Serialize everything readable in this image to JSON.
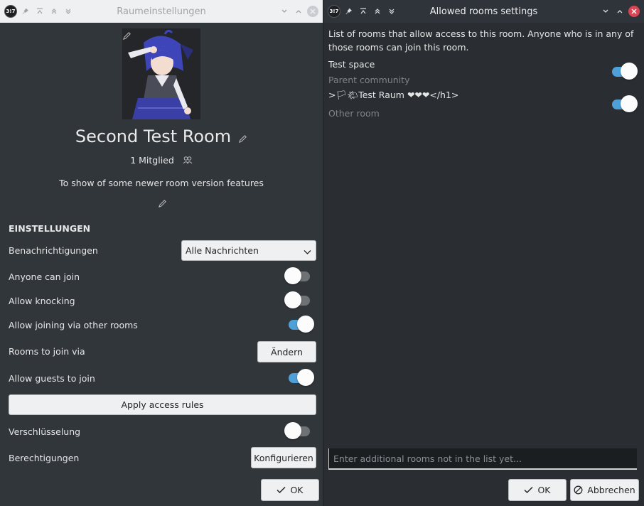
{
  "left_window": {
    "title": "Raumeinstellungen",
    "app_logo_text": "3!7",
    "room": {
      "name": "Second Test Room",
      "members": "1 Mitglied",
      "topic": "To show of some newer room version features"
    },
    "settings": {
      "section_title": "EINSTELLUNGEN",
      "notifications_label": "Benachrichtigungen",
      "notifications_value": "Alle Nachrichten",
      "anyone_can_join_label": "Anyone can join",
      "anyone_can_join": false,
      "allow_knocking_label": "Allow knocking",
      "allow_knocking": false,
      "allow_joining_via_rooms_label": "Allow joining via other rooms",
      "allow_joining_via_rooms": true,
      "rooms_to_join_label": "Rooms to join via",
      "rooms_to_join_button": "Ändern",
      "allow_guests_label": "Allow guests to join",
      "allow_guests": true,
      "apply_button": "Apply access rules",
      "encryption_label": "Verschlüsselung",
      "encryption": false,
      "permissions_label": "Berechtigungen",
      "permissions_button": "Konfigurieren"
    },
    "ok_button": "OK"
  },
  "right_window": {
    "title": "Allowed rooms settings",
    "app_logo_text": "3!7",
    "description": "List of rooms that allow access to this room. Anyone who is in any of those rooms can join this room.",
    "rooms": [
      {
        "name": "Test space",
        "subtitle": "Parent community",
        "enabled": true
      },
      {
        "name": ">🏳🌤Test Raum ❤❤❤</h1>",
        "subtitle": "Other room",
        "enabled": true
      }
    ],
    "input_placeholder": "Enter additional rooms not in the list yet...",
    "ok_button": "OK",
    "cancel_button": "Abbrechen"
  },
  "colors": {
    "window_bg": "#31363b",
    "accent": "#4fa0d8",
    "close_active": "#da4453"
  }
}
